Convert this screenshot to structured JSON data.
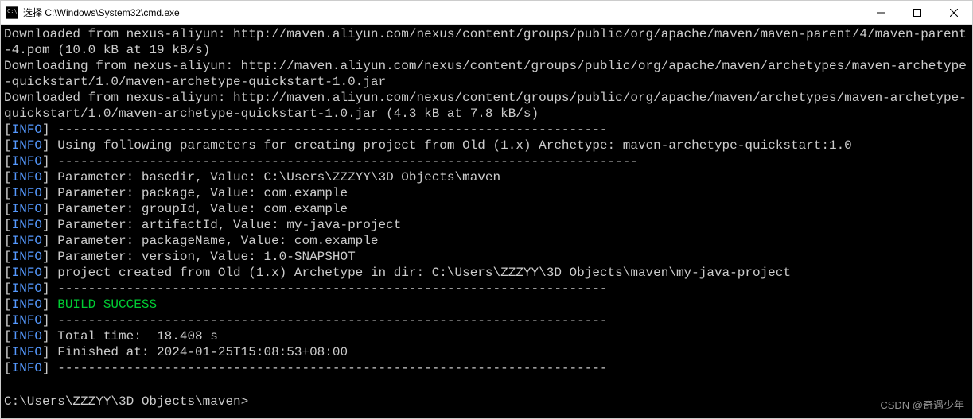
{
  "titlebar": {
    "title": "选择 C:\\Windows\\System32\\cmd.exe"
  },
  "term": {
    "l1": "Downloaded from nexus-aliyun: http://maven.aliyun.com/nexus/content/groups/public/org/apache/maven/maven-parent/4/maven-parent-4.pom (10.0 kB at 19 kB/s)",
    "l2": "Downloading from nexus-aliyun: http://maven.aliyun.com/nexus/content/groups/public/org/apache/maven/archetypes/maven-archetype-quickstart/1.0/maven-archetype-quickstart-1.0.jar",
    "l3a": "Downloaded from nexus-aliyun: http://maven.aliyun.com/nexus/content/groups/public/org/apache/maven/archetypes/maven-archetype-quickstart/1.0/maven-archetype-quickstart-1.0.jar (4.3 kB at 7.8 kB/s)",
    "info": "INFO",
    "dashline": "------------------------------------------------------------------------",
    "param_header": "Using following parameters for creating project from Old (1.x) Archetype: maven-archetype-quickstart:1.0",
    "dashline2": "----------------------------------------------------------------------------",
    "p_basedir": "Parameter: basedir, Value: C:\\Users\\ZZZYY\\3D Objects\\maven",
    "p_package": "Parameter: package, Value: com.example",
    "p_groupid": "Parameter: groupId, Value: com.example",
    "p_artifactid": "Parameter: artifactId, Value: my-java-project",
    "p_packagename": "Parameter: packageName, Value: com.example",
    "p_version": "Parameter: version, Value: 1.0-SNAPSHOT",
    "p_created": "project created from Old (1.x) Archetype in dir: C:\\Users\\ZZZYY\\3D Objects\\maven\\my-java-project",
    "build_success": "BUILD SUCCESS",
    "total_time": "Total time:  18.408 s",
    "finished_at": "Finished at: 2024-01-25T15:08:53+08:00",
    "prompt": "C:\\Users\\ZZZYY\\3D Objects\\maven>"
  },
  "watermark": "CSDN @奇遇少年"
}
